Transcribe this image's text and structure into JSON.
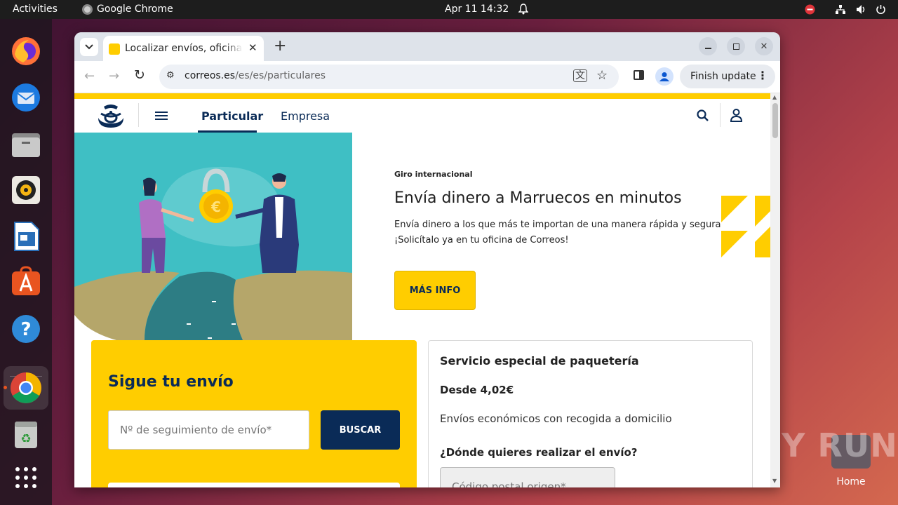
{
  "topbar": {
    "activities": "Activities",
    "app": "Google Chrome",
    "datetime": "Apr 11  14:32"
  },
  "dock": {
    "items": [
      "firefox-icon",
      "thunderbird-icon",
      "files-icon",
      "rhythmbox-icon",
      "writer-icon",
      "appcenter-icon",
      "help-icon",
      "chrome-icon",
      "trash-icon",
      "apps-grid-icon"
    ]
  },
  "desktop": {
    "home_label": "Home",
    "watermark": "ANY RUN"
  },
  "browser": {
    "tab_title": "Localizar envíos, oficinas",
    "url_host": "correos.es",
    "url_path": "/es/es/particulares",
    "finish_update": "Finish update"
  },
  "site": {
    "nav": {
      "particular": "Particular",
      "empresa": "Empresa"
    },
    "hero": {
      "eyebrow": "Giro internacional",
      "title": "Envía dinero a Marruecos en minutos",
      "body1": "Envía dinero a los que más te importan de una manera rápida y segura",
      "body2": "¡Solicítalo ya en tu oficina de Correos!",
      "cta": "MÁS INFO"
    },
    "track": {
      "title": "Sigue tu envío",
      "placeholder": "Nº de seguimiento de envío*",
      "button": "BUSCAR"
    },
    "parcel": {
      "title": "Servicio especial de paquetería",
      "price": "Desde 4,02€",
      "desc": "Envíos económicos con recogida a domicilio",
      "question": "¿Dónde quieres realizar el envío?",
      "origin_placeholder": "Código postal origen*"
    }
  },
  "colors": {
    "brand_yellow": "#ffcd00",
    "brand_navy": "#0a2b57",
    "hero_teal": "#3fbfc4"
  }
}
